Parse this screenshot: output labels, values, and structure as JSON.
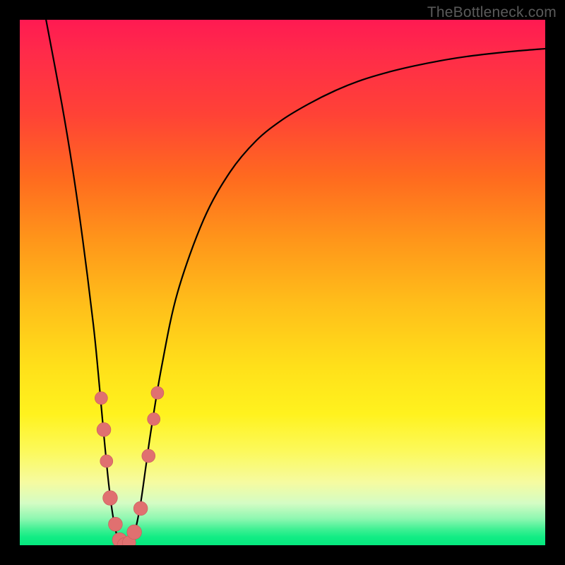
{
  "watermark": "TheBottleneck.com",
  "colors": {
    "frame": "#000000",
    "curve": "#000000",
    "dots": "#e07070",
    "gradient_top": "#ff1a52",
    "gradient_bottom": "#06e87e"
  },
  "chart_data": {
    "type": "line",
    "title": "",
    "xlabel": "",
    "ylabel": "",
    "xlim": [
      0,
      100
    ],
    "ylim": [
      0,
      100
    ],
    "grid": false,
    "series": [
      {
        "name": "bottleneck-curve",
        "x": [
          5,
          8,
          10,
          12,
          14,
          15,
          16,
          17,
          18,
          19,
          20,
          21,
          22,
          23,
          24,
          25,
          27,
          30,
          35,
          40,
          45,
          50,
          55,
          60,
          65,
          70,
          75,
          80,
          85,
          90,
          95,
          100
        ],
        "y": [
          100,
          84,
          72,
          58,
          42,
          32,
          21,
          11,
          4,
          0.5,
          0,
          0.5,
          3,
          8,
          15,
          22,
          34,
          48,
          62,
          71,
          77,
          81,
          84,
          86.5,
          88.5,
          90,
          91.2,
          92.2,
          93,
          93.6,
          94.1,
          94.5
        ]
      }
    ],
    "scatter_points": {
      "name": "highlighted-points",
      "points": [
        {
          "x": 15.5,
          "y": 28,
          "r": 2.0
        },
        {
          "x": 16.0,
          "y": 22,
          "r": 2.2
        },
        {
          "x": 16.5,
          "y": 16,
          "r": 2.0
        },
        {
          "x": 17.2,
          "y": 9,
          "r": 2.3
        },
        {
          "x": 18.2,
          "y": 4,
          "r": 2.2
        },
        {
          "x": 19.0,
          "y": 1,
          "r": 2.3
        },
        {
          "x": 20.0,
          "y": 0,
          "r": 2.4
        },
        {
          "x": 20.8,
          "y": 0.5,
          "r": 2.1
        },
        {
          "x": 21.8,
          "y": 2.5,
          "r": 2.3
        },
        {
          "x": 23.0,
          "y": 7,
          "r": 2.2
        },
        {
          "x": 24.5,
          "y": 17,
          "r": 2.1
        },
        {
          "x": 25.5,
          "y": 24,
          "r": 2.0
        },
        {
          "x": 26.2,
          "y": 29,
          "r": 2.0
        }
      ]
    }
  }
}
